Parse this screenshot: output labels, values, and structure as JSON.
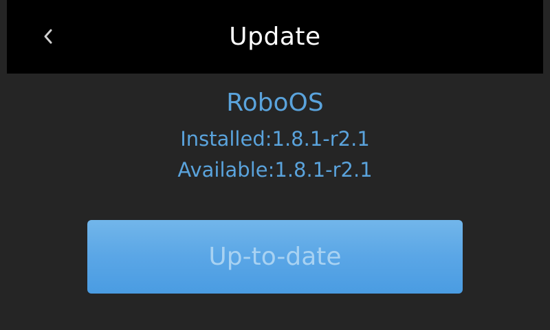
{
  "header": {
    "title": "Update",
    "back_icon": "chevron-left-icon"
  },
  "software": {
    "name": "RoboOS",
    "installed": "Installed:1.8.1-r2.1",
    "available": "Available:1.8.1-r2.1"
  },
  "action": {
    "label": "Up-to-date",
    "enabled": false
  },
  "colors": {
    "background": "#252525",
    "header_background": "#000000",
    "accent": "#5aa3dc",
    "button_background": "#5aa6e6",
    "button_text": "#a8d2f2"
  }
}
